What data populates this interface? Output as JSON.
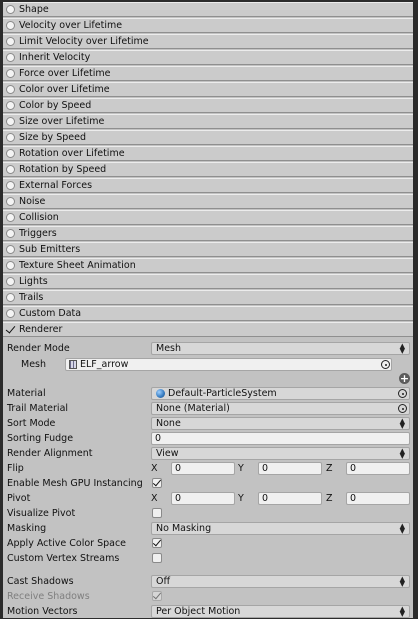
{
  "modules": [
    {
      "label": "Shape",
      "checked": false
    },
    {
      "label": "Velocity over Lifetime",
      "checked": false
    },
    {
      "label": "Limit Velocity over Lifetime",
      "checked": false
    },
    {
      "label": "Inherit Velocity",
      "checked": false
    },
    {
      "label": "Force over Lifetime",
      "checked": false
    },
    {
      "label": "Color over Lifetime",
      "checked": false
    },
    {
      "label": "Color by Speed",
      "checked": false
    },
    {
      "label": "Size over Lifetime",
      "checked": false
    },
    {
      "label": "Size by Speed",
      "checked": false
    },
    {
      "label": "Rotation over Lifetime",
      "checked": false
    },
    {
      "label": "Rotation by Speed",
      "checked": false
    },
    {
      "label": "External Forces",
      "checked": false
    },
    {
      "label": "Noise",
      "checked": false
    },
    {
      "label": "Collision",
      "checked": false
    },
    {
      "label": "Triggers",
      "checked": false
    },
    {
      "label": "Sub Emitters",
      "checked": false
    },
    {
      "label": "Texture Sheet Animation",
      "checked": false
    },
    {
      "label": "Lights",
      "checked": false
    },
    {
      "label": "Trails",
      "checked": false
    },
    {
      "label": "Custom Data",
      "checked": false
    },
    {
      "label": "Renderer",
      "checked": true
    }
  ],
  "renderer": {
    "render_mode": {
      "label": "Render Mode",
      "value": "Mesh"
    },
    "mesh": {
      "label": "Mesh",
      "value": "ELF_arrow"
    },
    "material": {
      "label": "Material",
      "value": "Default-ParticleSystem"
    },
    "trail_material": {
      "label": "Trail Material",
      "value": "None (Material)"
    },
    "sort_mode": {
      "label": "Sort Mode",
      "value": "None"
    },
    "sorting_fudge": {
      "label": "Sorting Fudge",
      "value": "0"
    },
    "render_alignment": {
      "label": "Render Alignment",
      "value": "View"
    },
    "flip": {
      "label": "Flip",
      "x": "0",
      "y": "0",
      "z": "0"
    },
    "gpu_instancing": {
      "label": "Enable Mesh GPU Instancing",
      "checked": true
    },
    "pivot": {
      "label": "Pivot",
      "x": "0",
      "y": "0",
      "z": "0"
    },
    "visualize_pivot": {
      "label": "Visualize Pivot",
      "checked": false
    },
    "masking": {
      "label": "Masking",
      "value": "No Masking"
    },
    "apply_active_color_space": {
      "label": "Apply Active Color Space",
      "checked": true
    },
    "custom_vertex_streams": {
      "label": "Custom Vertex Streams",
      "checked": false
    },
    "cast_shadows": {
      "label": "Cast Shadows",
      "value": "Off"
    },
    "receive_shadows": {
      "label": "Receive Shadows",
      "checked": true
    },
    "motion_vectors": {
      "label": "Motion Vectors",
      "value": "Per Object Motion"
    },
    "axis_labels": {
      "x": "X",
      "y": "Y",
      "z": "Z"
    }
  }
}
